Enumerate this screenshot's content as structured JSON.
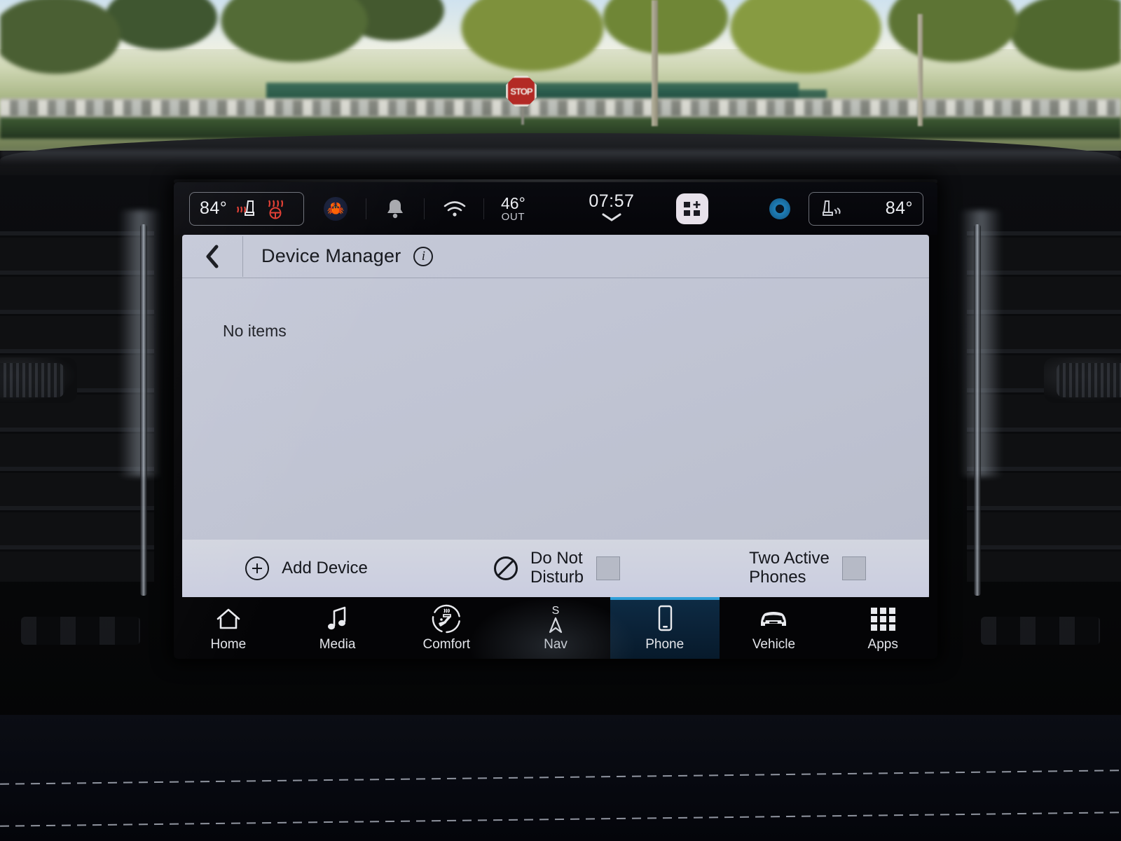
{
  "status_bar": {
    "left_zone_temp": "84°",
    "right_zone_temp": "84°",
    "outside_temp_value": "46°",
    "outside_temp_label": "OUT",
    "clock": "07:57",
    "icons": {
      "seat_heat": "heated-seat-icon",
      "wheel_heat": "heated-steering-wheel-icon",
      "profile": "🦀",
      "bell": "notification-bell-icon",
      "wifi": "wifi-icon",
      "add_widget": "add-widget-icon",
      "assistant": "voice-assistant-icon",
      "right_seat": "passenger-seat-icon",
      "clock_chevron": "chevron-down-icon"
    }
  },
  "app": {
    "title": "Device Manager",
    "back_icon": "back-chevron-icon",
    "info_icon": "i",
    "empty_message": "No items"
  },
  "actions": [
    {
      "label": "Add Device",
      "icon": "plus-circle-icon",
      "has_checkbox": false,
      "checked": false
    },
    {
      "label": "Do Not Disturb",
      "label_line1": "Do Not",
      "label_line2": "Disturb",
      "icon": "do-not-disturb-icon",
      "has_checkbox": true,
      "checked": false
    },
    {
      "label": "Two Active Phones",
      "label_line1": "Two Active",
      "label_line2": "Phones",
      "icon": null,
      "has_checkbox": true,
      "checked": false
    }
  ],
  "nav": {
    "active": "Phone",
    "items": [
      {
        "label": "Home",
        "icon": "home-icon"
      },
      {
        "label": "Media",
        "icon": "music-note-icon"
      },
      {
        "label": "Comfort",
        "icon": "comfort-seat-icon"
      },
      {
        "label": "Nav",
        "icon": "compass-south-icon"
      },
      {
        "label": "Phone",
        "icon": "phone-icon"
      },
      {
        "label": "Vehicle",
        "icon": "car-front-icon"
      },
      {
        "label": "Apps",
        "icon": "grid-apps-icon"
      }
    ]
  },
  "colors": {
    "accent": "#2f9fd8",
    "active_tab_bg": "#0b2339",
    "panel_bg": "#c0c4d3",
    "action_bar_bg": "#d0d3de",
    "screen_bg": "#040406",
    "text_dark": "#14161c",
    "text_light": "#e9eaee"
  },
  "exterior": {
    "sign_text": "STOP"
  }
}
